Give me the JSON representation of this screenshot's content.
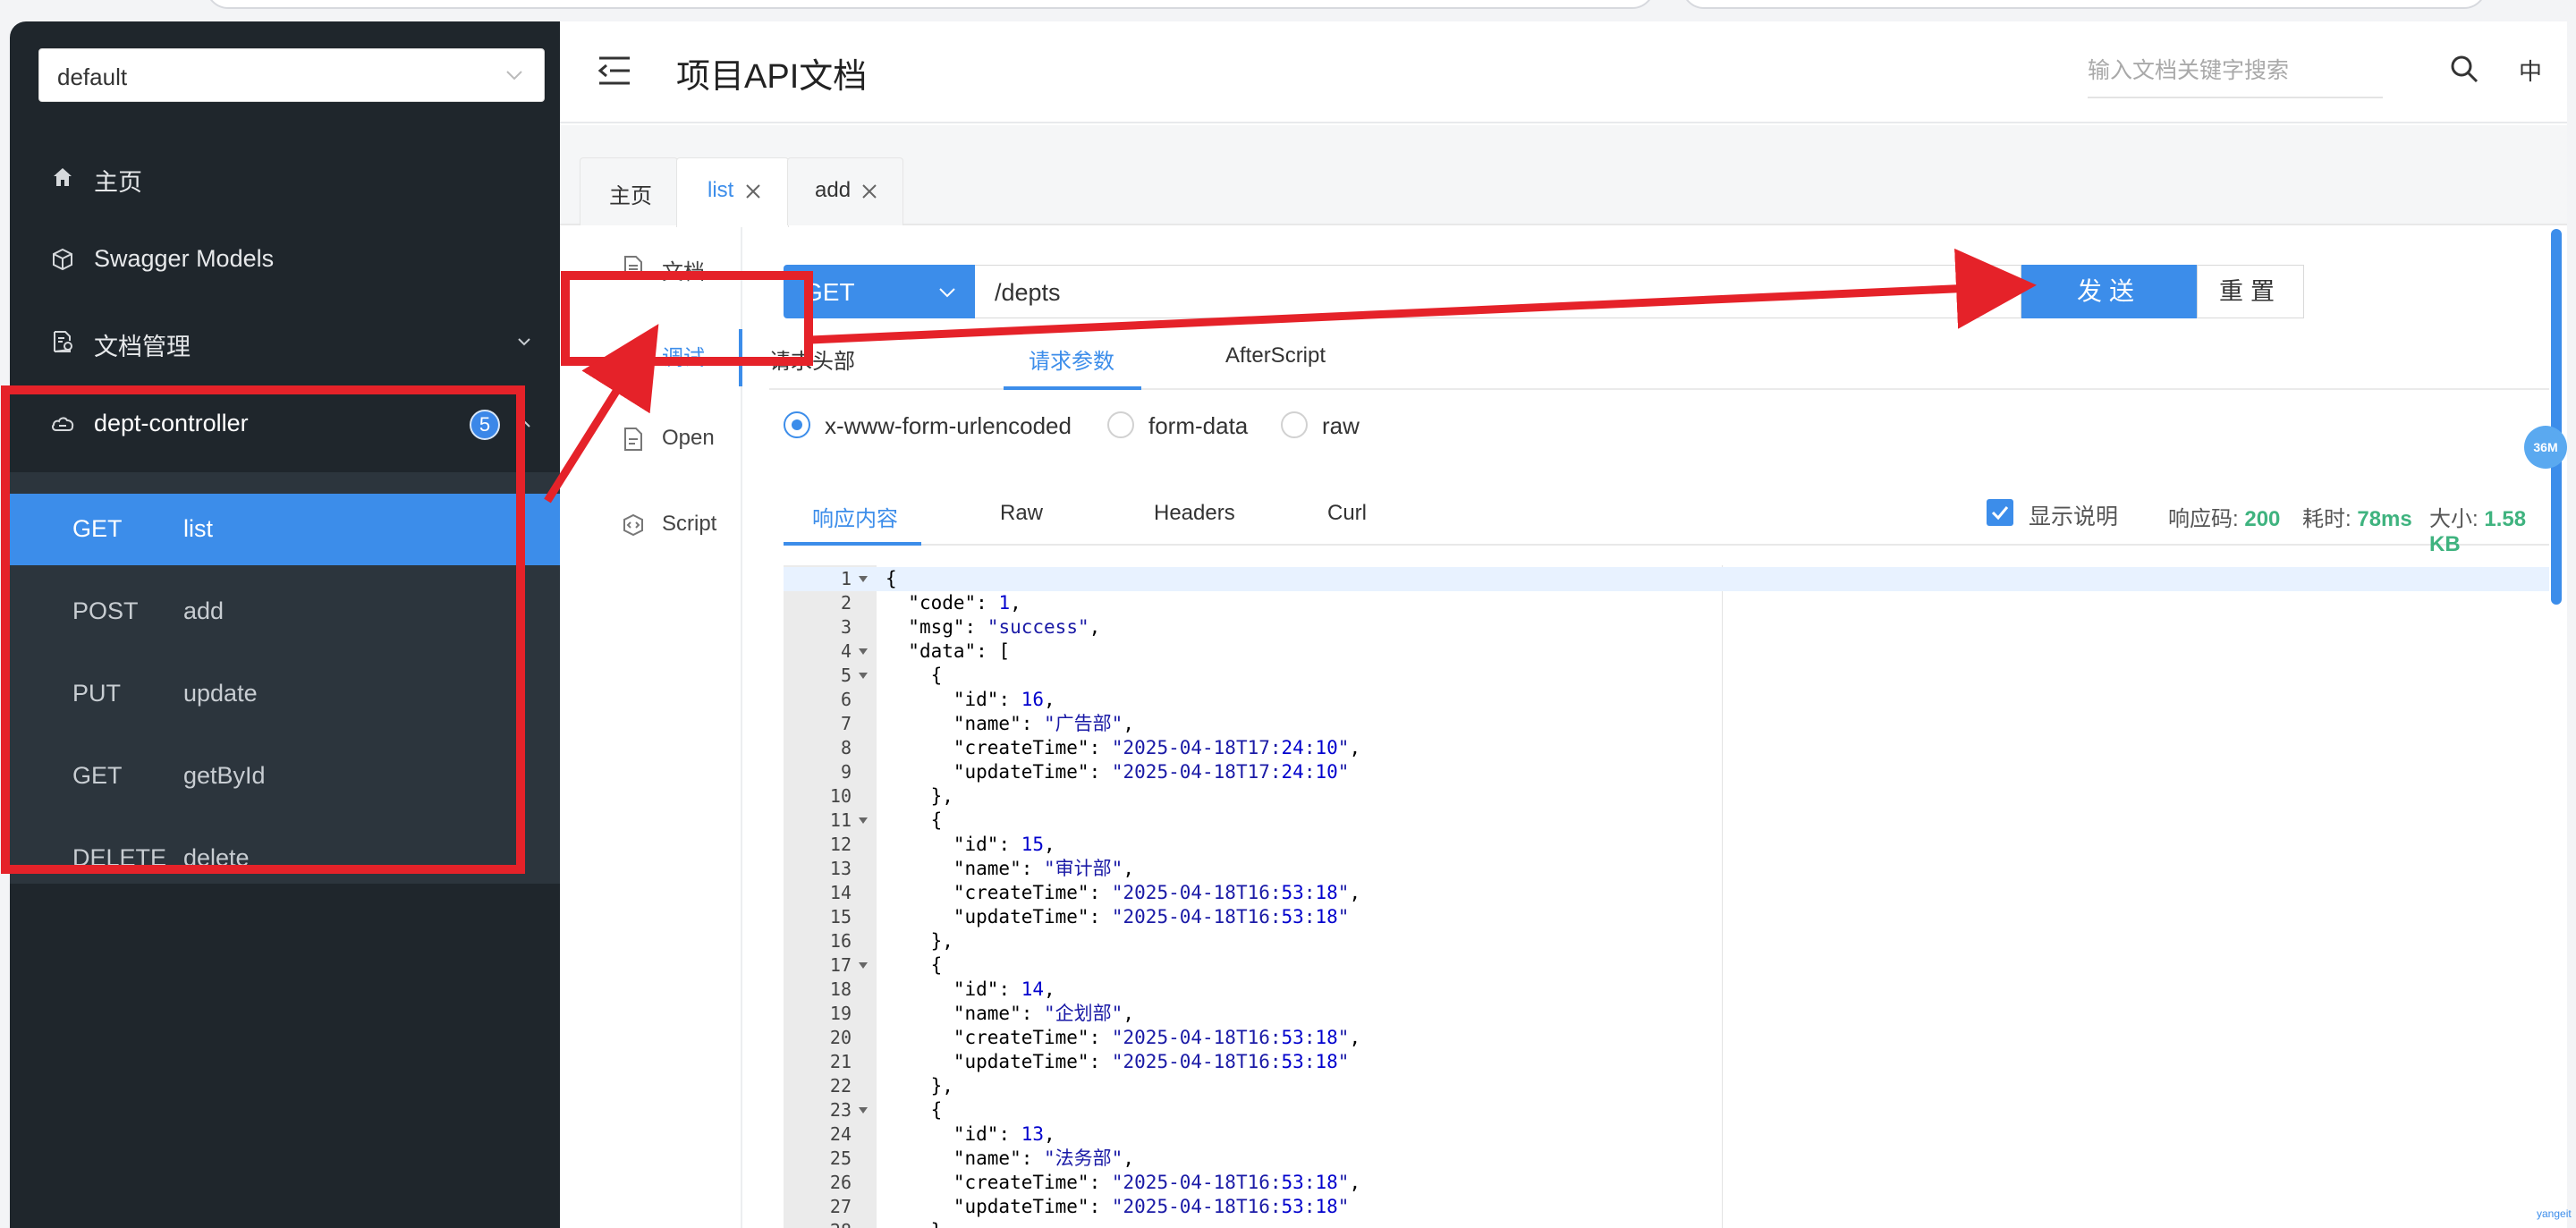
{
  "sidebar": {
    "group_value": "default",
    "menu": [
      {
        "label": "主页",
        "icon": "home-icon"
      },
      {
        "label": "Swagger Models",
        "icon": "cube-icon"
      },
      {
        "label": "文档管理",
        "icon": "document-settings-icon"
      },
      {
        "label": "dept-controller",
        "icon": "cloud-icon",
        "badge": "5"
      }
    ],
    "apis": [
      {
        "method": "GET",
        "path": "list",
        "active": true
      },
      {
        "method": "POST",
        "path": "add"
      },
      {
        "method": "PUT",
        "path": "update"
      },
      {
        "method": "GET",
        "path": "getById"
      },
      {
        "method": "DELETE",
        "path": "delete"
      }
    ]
  },
  "header": {
    "title": "项目API文档",
    "search_placeholder": "输入文档关键字搜索",
    "lang": "中"
  },
  "tabs": [
    {
      "label": "主页"
    },
    {
      "label": "list",
      "active": true
    },
    {
      "label": "add"
    }
  ],
  "subnav": [
    {
      "label": "文档",
      "icon": "file-icon"
    },
    {
      "label": "调试",
      "icon": "bug-icon",
      "active": true
    },
    {
      "label": "Open",
      "icon": "file-icon"
    },
    {
      "label": "Script",
      "icon": "code-icon"
    }
  ],
  "request": {
    "method": "GET",
    "url": "/depts",
    "send_label": "发送",
    "reset_label": "重置",
    "tabs": [
      "请求头部",
      "请求参数",
      "AfterScript"
    ],
    "body_types": [
      "x-www-form-urlencoded",
      "form-data",
      "raw"
    ]
  },
  "response": {
    "tabs": [
      "响应内容",
      "Raw",
      "Headers",
      "Curl"
    ],
    "show_desc_label": "显示说明",
    "code_label": "响应码:",
    "code_value": "200",
    "time_label": "耗时:",
    "time_value": "78ms",
    "size_label": "大小:",
    "size_value": "1.58 KB",
    "lines": [
      "{",
      "  \"code\": 1,",
      "  \"msg\": \"success\",",
      "  \"data\": [",
      "    {",
      "      \"id\": 16,",
      "      \"name\": \"广告部\",",
      "      \"createTime\": \"2025-04-18T17:24:10\",",
      "      \"updateTime\": \"2025-04-18T17:24:10\"",
      "    },",
      "    {",
      "      \"id\": 15,",
      "      \"name\": \"审计部\",",
      "      \"createTime\": \"2025-04-18T16:53:18\",",
      "      \"updateTime\": \"2025-04-18T16:53:18\"",
      "    },",
      "    {",
      "      \"id\": 14,",
      "      \"name\": \"企划部\",",
      "      \"createTime\": \"2025-04-18T16:53:18\",",
      "      \"updateTime\": \"2025-04-18T16:53:18\"",
      "    },",
      "    {",
      "      \"id\": 13,",
      "      \"name\": \"法务部\",",
      "      \"createTime\": \"2025-04-18T16:53:18\",",
      "      \"updateTime\": \"2025-04-18T16:53:18\"",
      "    },",
      "    {"
    ],
    "fold_lines": [
      1,
      4,
      5,
      11,
      17,
      23
    ]
  },
  "misc": {
    "mem_badge": "36M",
    "watermark": "yangeit"
  },
  "colors": {
    "accent": "#3c8dea",
    "sidebar_bg": "#1f262c",
    "annotation_red": "#e52229",
    "success_green": "#3fb37f"
  }
}
